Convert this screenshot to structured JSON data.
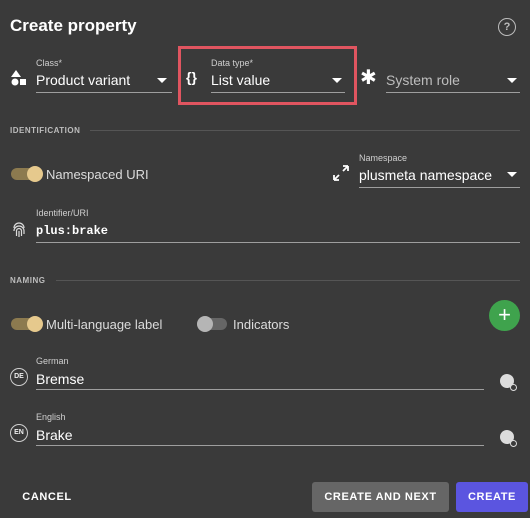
{
  "dialog": {
    "title": "Create property",
    "help_icon": "help-circle-icon"
  },
  "fields": {
    "class": {
      "label": "Class*",
      "value": "Product variant",
      "icon": "shapes-icon"
    },
    "data_type": {
      "label": "Data type*",
      "value": "List value",
      "icon": "curly-braces-icon"
    },
    "system_role": {
      "placeholder": "System role",
      "icon": "asterisk-icon"
    }
  },
  "identification": {
    "section_label": "IDENTIFICATION",
    "namespaced_toggle": {
      "label": "Namespaced URI",
      "on": true
    },
    "namespace": {
      "label": "Namespace",
      "value": "plusmeta namespace",
      "icon": "expand-arrows-icon"
    },
    "identifier": {
      "label": "Identifier/URI",
      "value": "plus:brake",
      "icon": "fingerprint-icon"
    }
  },
  "naming": {
    "section_label": "NAMING",
    "multilang_toggle": {
      "label": "Multi-language label",
      "on": true
    },
    "indicators_toggle": {
      "label": "Indicators",
      "on": false
    },
    "add_button": "+",
    "languages": [
      {
        "code": "DE",
        "label": "German",
        "value": "Bremse"
      },
      {
        "code": "EN",
        "label": "English",
        "value": "Brake"
      }
    ]
  },
  "actions": {
    "cancel": "CANCEL",
    "create_and_next": "CREATE AND NEXT",
    "create": "CREATE"
  },
  "colors": {
    "background": "#3a3a3a",
    "highlight": "#e05560",
    "primary": "#5b55e0",
    "add_button": "#3fa34d",
    "toggle_on": "#e6c98d"
  }
}
